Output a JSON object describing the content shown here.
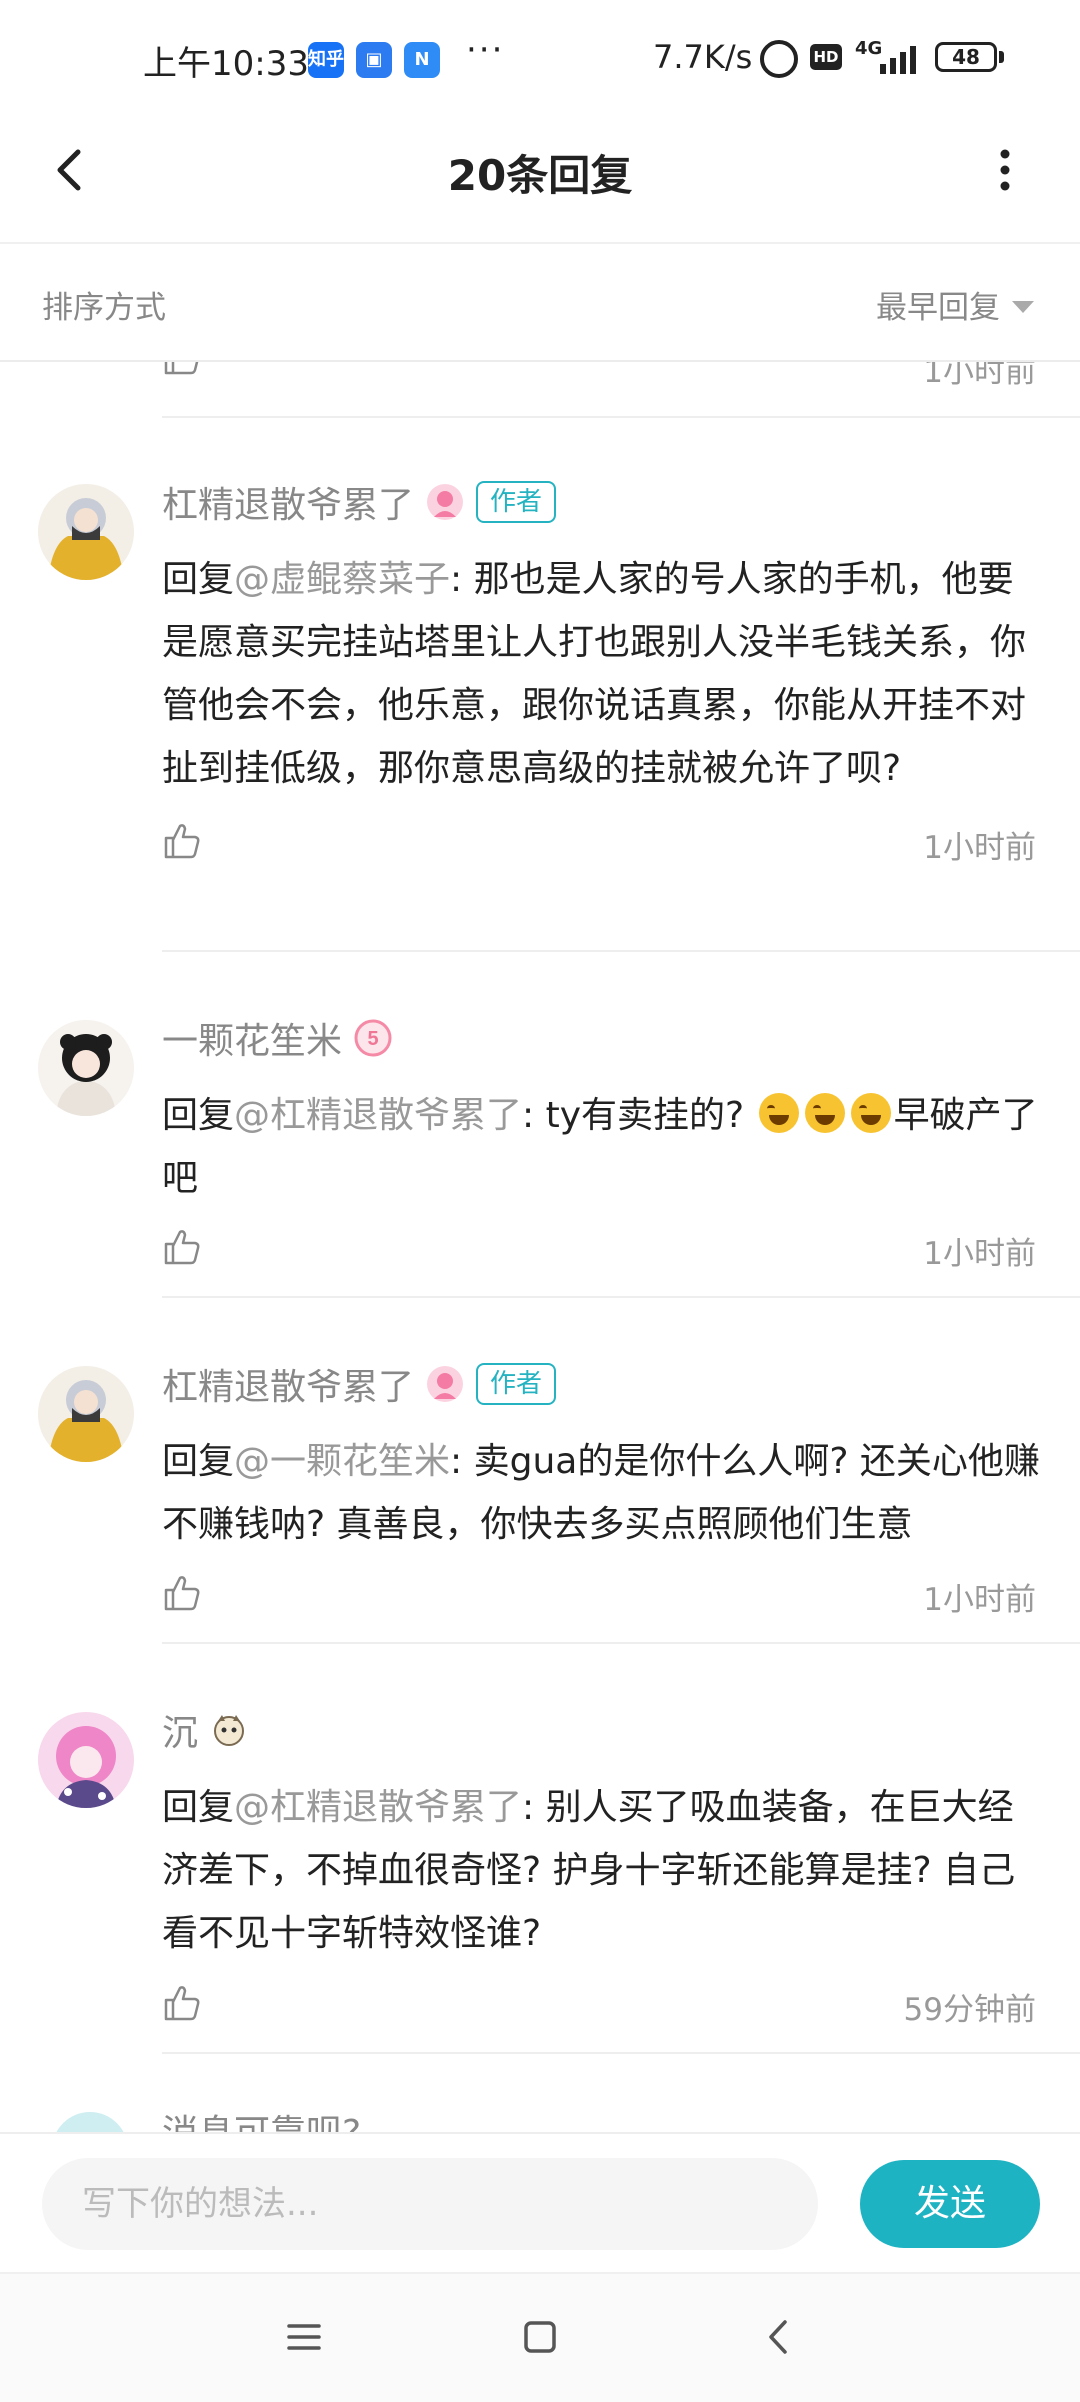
{
  "status_bar": {
    "time": "上午10:33",
    "apps": [
      {
        "name": "知乎",
        "color": "#1772f6"
      },
      {
        "name": "▣",
        "color": "#2d7bf0"
      },
      {
        "name": "N",
        "color": "#2f8cf7"
      }
    ],
    "more": "···",
    "net_speed": "7.7K/s",
    "hd": "HD",
    "network": "4G",
    "battery": "48"
  },
  "header": {
    "title": "20条回复"
  },
  "sort": {
    "label": "排序方式",
    "selected": "最早回复"
  },
  "previous_partial": {
    "time": "1小时前"
  },
  "comments": [
    {
      "author": "杠精退散爷累了",
      "badge_color": "#f5a6c0",
      "tag": "作者",
      "reply_prefix": "回复",
      "mention": "@虚鲲蔡菜子",
      "text": ": 那也是人家的号人家的手机，他要是愿意买完挂站塔里让人打也跟别人没半毛钱关系，你管他会不会，他乐意，跟你说话真累，你能从开挂不对扯到挂低级，那你意思高级的挂就被允许了呗?",
      "time": "1小时前"
    },
    {
      "author": "一颗花笙米",
      "badge_color": "#f58aa6",
      "badge_text": "5",
      "tag": "",
      "reply_prefix": "回复",
      "mention": "@杠精退散爷累了",
      "text_before": ": ty有卖挂的?",
      "text_after": "早破产了吧",
      "emoji_count": 3,
      "time": "1小时前"
    },
    {
      "author": "杠精退散爷累了",
      "badge_color": "#f5a6c0",
      "tag": "作者",
      "reply_prefix": "回复",
      "mention": "@一颗花笙米",
      "text": ": 卖gua的是你什么人啊? 还关心他赚不赚钱呐? 真善良，你快去多买点照顾他们生意",
      "time": "1小时前"
    },
    {
      "author": "沉",
      "badge_color": "#e8d8b0",
      "tag": "",
      "reply_prefix": "回复",
      "mention": "@杠精退散爷累了",
      "text": ": 别人买了吸血装备，在巨大经济差下，不掉血很奇怪? 护身十字斩还能算是挂? 自己看不见十字斩特效怪谁?",
      "time": "59分钟前"
    }
  ],
  "next_partial": {
    "author": "消息可靠呗?"
  },
  "composer": {
    "placeholder": "写下你的想法...",
    "send_label": "发送"
  },
  "colors": {
    "accent": "#1eb3c3",
    "tag": "#25b3c2"
  }
}
